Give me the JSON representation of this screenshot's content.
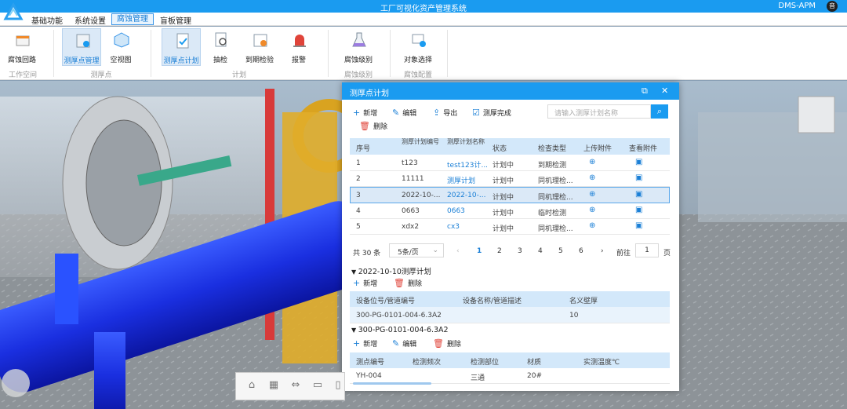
{
  "app": {
    "title": "工厂可视化资产管理系统",
    "user": "DMS-APM",
    "avatar": "音"
  },
  "menu": [
    "基础功能",
    "系统设置",
    "腐蚀管理",
    "盲板管理"
  ],
  "ribbon": {
    "buttons": [
      "腐蚀回路",
      "测厚点管理",
      "空视图",
      "测厚点计划",
      "抽检",
      "到期检验",
      "报警",
      "腐蚀级别",
      "对象选择"
    ],
    "groups": [
      "工作空间",
      "测厚点",
      "计划",
      "腐蚀级别",
      "腐蚀配置"
    ]
  },
  "panel": {
    "title": "测厚点计划",
    "toolbar": {
      "add": "新增",
      "edit": "编辑",
      "export": "导出",
      "done": "测厚完成",
      "delete": "删除"
    },
    "search_placeholder": "请输入测厚计划名称",
    "columns": [
      "序号",
      "测厚计划编号",
      "测厚计划名称",
      "状态",
      "检查类型",
      "上传附件",
      "查看附件"
    ],
    "rows": [
      {
        "no": "1",
        "code": "t123",
        "name": "test123计...",
        "status": "计划中",
        "type": "到期检测"
      },
      {
        "no": "2",
        "code": "11111",
        "name": "测厚计划",
        "status": "计划中",
        "type": "同机理检..."
      },
      {
        "no": "3",
        "code": "2022-10-...",
        "name": "2022-10-...",
        "status": "计划中",
        "type": "同机理检..."
      },
      {
        "no": "4",
        "code": "0663",
        "name": "0663",
        "status": "计划中",
        "type": "临时检测"
      },
      {
        "no": "5",
        "code": "xdx2",
        "name": "cx3",
        "status": "计划中",
        "type": "同机理检..."
      }
    ],
    "pagination": {
      "total": "共 30 条",
      "size": "5条/页",
      "pages": [
        "1",
        "2",
        "3",
        "4",
        "5",
        "6"
      ],
      "goto": "前往",
      "current": "1",
      "unit": "页"
    },
    "section1": {
      "title": "2022-10-10测厚计划",
      "add": "新增",
      "delete": "删除",
      "columns": [
        "设备位号/管道编号",
        "设备名称/管道描述",
        "名义壁厚"
      ],
      "row": [
        "300-PG-0101-004-6.3A2",
        "",
        "10"
      ]
    },
    "section2": {
      "title": "300-PG-0101-004-6.3A2",
      "add": "新增",
      "edit": "编辑",
      "delete": "删除",
      "columns": [
        "测点编号",
        "检测频次",
        "检测部位",
        "材质",
        "实测温度℃"
      ],
      "row": [
        "YH-004",
        "",
        "三通",
        "20#",
        ""
      ]
    }
  },
  "colors": {
    "primary": "#1a9bf0",
    "header_bg": "#d3e8fa",
    "selected_row": "#dbe9f7",
    "danger": "#e0443a"
  }
}
